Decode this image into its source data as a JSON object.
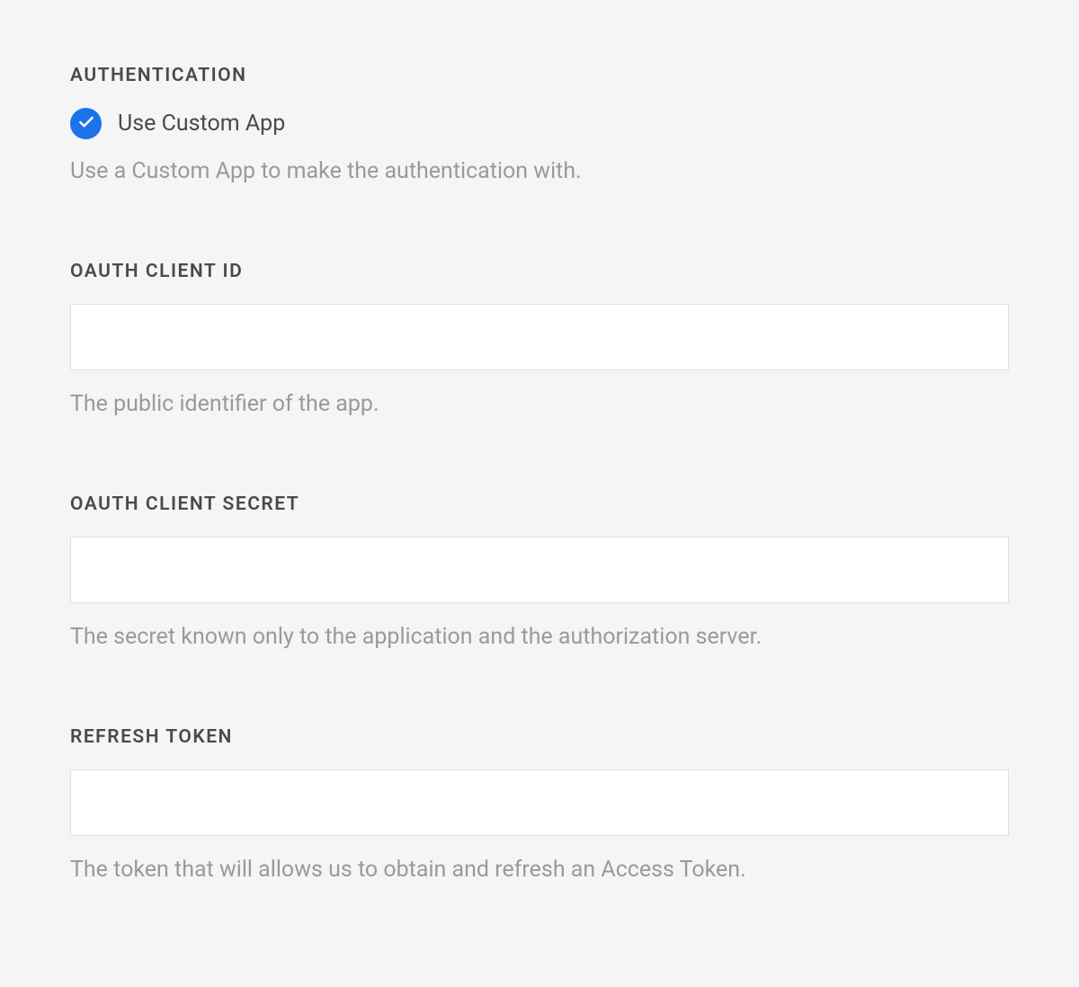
{
  "authentication": {
    "label": "AUTHENTICATION",
    "checkbox": {
      "checked": true,
      "label": "Use Custom App"
    },
    "help": "Use a Custom App to make the authentication with."
  },
  "oauth_client_id": {
    "label": "OAUTH CLIENT ID",
    "value": "",
    "help": "The public identifier of the app."
  },
  "oauth_client_secret": {
    "label": "OAUTH CLIENT SECRET",
    "value": "",
    "help": "The secret known only to the application and the authorization server."
  },
  "refresh_token": {
    "label": "REFRESH TOKEN",
    "value": "",
    "help": "The token that will allows us to obtain and refresh an Access Token."
  }
}
